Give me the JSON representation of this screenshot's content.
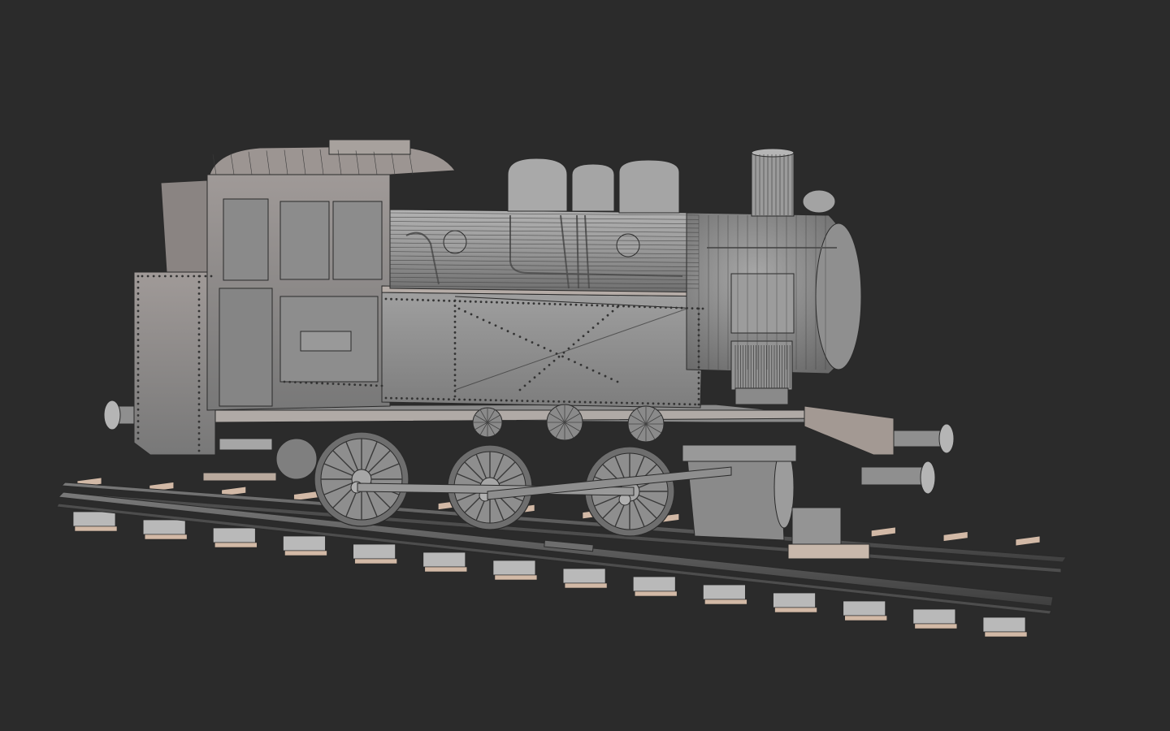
{
  "viewport": {
    "background": "#2b2b2b",
    "mode": "wireframe-overlay"
  },
  "scene": {
    "object": "steam-tank-locomotive",
    "colors": {
      "body": "#8e8e8e",
      "body_light": "#a6a6a6",
      "body_dark": "#6e6e6e",
      "wire": "#2a2a2a",
      "sleeper_top": "#b9b9b9",
      "sleeper_side": "#d2b9a6",
      "rail": "#5a5a5a"
    },
    "sleeper_count": 14,
    "driving_wheel_count": 3
  }
}
